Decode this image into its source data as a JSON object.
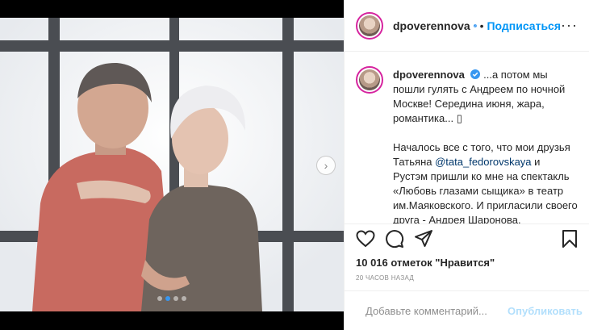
{
  "post": {
    "username": "dpoverennova",
    "separator": "•",
    "follow_label": "Подписаться",
    "more_label": "···",
    "caption": {
      "username": "dpoverennova",
      "line1": "...а потом мы пошли гулять с Андреем по ночной Москве! Середина июня, жара, романтика... ",
      "emoji": "▯",
      "line2_start": "Началось все с того, что мои друзья Татьяна ",
      "mention": "@tata_fedorovskaya",
      "line2_end": " и Рустэм пришли ко мне на спектакль «Любовь глазами сыщика» в театр им.Маяковского. И пригласили своего друга - Андрея Шаронова."
    },
    "likes": "10 016 отметок \"Нравится\"",
    "time_ago": "20 ЧАСОВ НАЗАД",
    "comment_placeholder": "Добавьте комментарий...",
    "publish_label": "Опубликовать",
    "carousel": {
      "total_slides": 4,
      "active_index": 1
    },
    "icons": {
      "like": "heart-icon",
      "comment": "comment-icon",
      "share": "share-icon",
      "save": "bookmark-icon",
      "emoji": "smiley-icon",
      "verified": "verified-badge-icon",
      "next": "chevron-right-icon"
    },
    "colors": {
      "accent": "#0095f6",
      "verified": "#3897f0",
      "publish_disabled": "#b2dffc"
    }
  }
}
